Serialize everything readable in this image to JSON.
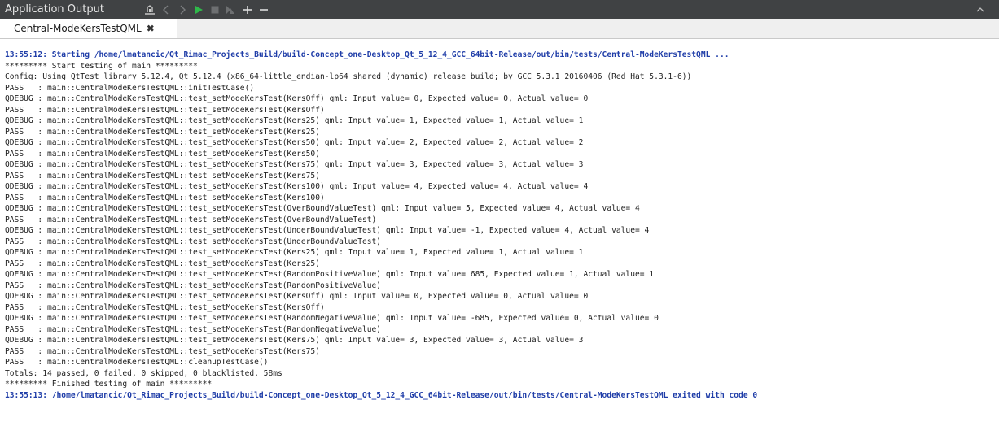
{
  "toolbar": {
    "title": "Application Output",
    "icons": [
      "attach-icon",
      "prev-arrow-icon",
      "next-arrow-icon",
      "run-icon",
      "stop-icon",
      "attach-debugger-icon",
      "zoom-in-icon",
      "zoom-out-icon",
      "collapse-icon"
    ]
  },
  "tab": {
    "label": "Central-ModeKersTestQML",
    "close": "✖"
  },
  "output": {
    "lines": [
      {
        "text": "13:55:12: Starting /home/lmatancic/Qt_Rimac_Projects_Build/build-Concept_one-Desktop_Qt_5_12_4_GCC_64bit-Release/out/bin/tests/Central-ModeKersTestQML ...",
        "kind": "info"
      },
      {
        "text": "********* Start testing of main *********",
        "kind": "normal"
      },
      {
        "text": "Config: Using QtTest library 5.12.4, Qt 5.12.4 (x86_64-little_endian-lp64 shared (dynamic) release build; by GCC 5.3.1 20160406 (Red Hat 5.3.1-6))",
        "kind": "normal"
      },
      {
        "text": "PASS   : main::CentralModeKersTestQML::initTestCase()",
        "kind": "normal"
      },
      {
        "text": "QDEBUG : main::CentralModeKersTestQML::test_setModeKersTest(KersOff) qml: Input value= 0, Expected value= 0, Actual value= 0",
        "kind": "normal"
      },
      {
        "text": "PASS   : main::CentralModeKersTestQML::test_setModeKersTest(KersOff)",
        "kind": "normal"
      },
      {
        "text": "QDEBUG : main::CentralModeKersTestQML::test_setModeKersTest(Kers25) qml: Input value= 1, Expected value= 1, Actual value= 1",
        "kind": "normal"
      },
      {
        "text": "PASS   : main::CentralModeKersTestQML::test_setModeKersTest(Kers25)",
        "kind": "normal"
      },
      {
        "text": "QDEBUG : main::CentralModeKersTestQML::test_setModeKersTest(Kers50) qml: Input value= 2, Expected value= 2, Actual value= 2",
        "kind": "normal"
      },
      {
        "text": "PASS   : main::CentralModeKersTestQML::test_setModeKersTest(Kers50)",
        "kind": "normal"
      },
      {
        "text": "QDEBUG : main::CentralModeKersTestQML::test_setModeKersTest(Kers75) qml: Input value= 3, Expected value= 3, Actual value= 3",
        "kind": "normal"
      },
      {
        "text": "PASS   : main::CentralModeKersTestQML::test_setModeKersTest(Kers75)",
        "kind": "normal"
      },
      {
        "text": "QDEBUG : main::CentralModeKersTestQML::test_setModeKersTest(Kers100) qml: Input value= 4, Expected value= 4, Actual value= 4",
        "kind": "normal"
      },
      {
        "text": "PASS   : main::CentralModeKersTestQML::test_setModeKersTest(Kers100)",
        "kind": "normal"
      },
      {
        "text": "QDEBUG : main::CentralModeKersTestQML::test_setModeKersTest(OverBoundValueTest) qml: Input value= 5, Expected value= 4, Actual value= 4",
        "kind": "normal"
      },
      {
        "text": "PASS   : main::CentralModeKersTestQML::test_setModeKersTest(OverBoundValueTest)",
        "kind": "normal"
      },
      {
        "text": "QDEBUG : main::CentralModeKersTestQML::test_setModeKersTest(UnderBoundValueTest) qml: Input value= -1, Expected value= 4, Actual value= 4",
        "kind": "normal"
      },
      {
        "text": "PASS   : main::CentralModeKersTestQML::test_setModeKersTest(UnderBoundValueTest)",
        "kind": "normal"
      },
      {
        "text": "QDEBUG : main::CentralModeKersTestQML::test_setModeKersTest(Kers25) qml: Input value= 1, Expected value= 1, Actual value= 1",
        "kind": "normal"
      },
      {
        "text": "PASS   : main::CentralModeKersTestQML::test_setModeKersTest(Kers25)",
        "kind": "normal"
      },
      {
        "text": "QDEBUG : main::CentralModeKersTestQML::test_setModeKersTest(RandomPositiveValue) qml: Input value= 685, Expected value= 1, Actual value= 1",
        "kind": "normal"
      },
      {
        "text": "PASS   : main::CentralModeKersTestQML::test_setModeKersTest(RandomPositiveValue)",
        "kind": "normal"
      },
      {
        "text": "QDEBUG : main::CentralModeKersTestQML::test_setModeKersTest(KersOff) qml: Input value= 0, Expected value= 0, Actual value= 0",
        "kind": "normal"
      },
      {
        "text": "PASS   : main::CentralModeKersTestQML::test_setModeKersTest(KersOff)",
        "kind": "normal"
      },
      {
        "text": "QDEBUG : main::CentralModeKersTestQML::test_setModeKersTest(RandomNegativeValue) qml: Input value= -685, Expected value= 0, Actual value= 0",
        "kind": "normal"
      },
      {
        "text": "PASS   : main::CentralModeKersTestQML::test_setModeKersTest(RandomNegativeValue)",
        "kind": "normal"
      },
      {
        "text": "QDEBUG : main::CentralModeKersTestQML::test_setModeKersTest(Kers75) qml: Input value= 3, Expected value= 3, Actual value= 3",
        "kind": "normal"
      },
      {
        "text": "PASS   : main::CentralModeKersTestQML::test_setModeKersTest(Kers75)",
        "kind": "normal"
      },
      {
        "text": "PASS   : main::CentralModeKersTestQML::cleanupTestCase()",
        "kind": "normal"
      },
      {
        "text": "Totals: 14 passed, 0 failed, 0 skipped, 0 blacklisted, 58ms",
        "kind": "normal"
      },
      {
        "text": "********* Finished testing of main *********",
        "kind": "normal"
      },
      {
        "text": "13:55:13: /home/lmatancic/Qt_Rimac_Projects_Build/build-Concept_one-Desktop_Qt_5_12_4_GCC_64bit-Release/out/bin/tests/Central-ModeKersTestQML exited with code 0",
        "kind": "info"
      }
    ]
  },
  "colors": {
    "toolbar_bg": "#404244",
    "info_text": "#1f3da8",
    "run_green": "#2fb84a"
  }
}
